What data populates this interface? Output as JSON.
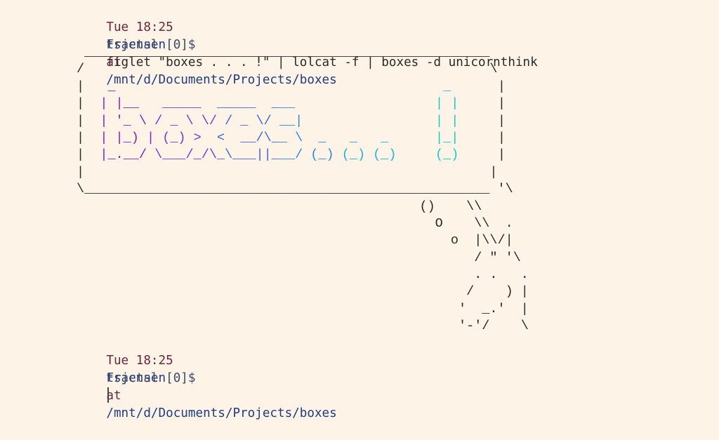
{
  "prompt1": {
    "time": "Tue 18:25",
    "user": "tsjensen",
    "at": "at",
    "path": "/mnt/d/Documents/Projects/boxes",
    "host": "Fractal [0]$",
    "command": "figlet \"boxes . . . !\" | lolcat -f | boxes -d unicornthink"
  },
  "art": {
    "border_lines": [
      " ____________________________________________________",
      "/                                                    \\",
      "|                                                    |",
      "|                                                    |",
      "|                                                    |",
      "|                                                    |",
      "|                                                    |",
      "|                                                    |",
      "\\____________________________________________________ '\\"
    ],
    "figlet_lines": [
      "  _                                          _  ",
      " | |__   _____  _____  ___                  | | ",
      " | '_ \\ / _ \\ \\/ / _ \\/ __|                 | | ",
      " | |_) | (_) >  <  __/\\__ \\  _   _   _      |_| ",
      " |_.__/ \\___/_/\\_\\___||___/ (_) (_) (_)     (_) "
    ],
    "unicorn_lines": [
      "                                            ()    \\\\",
      "                                              O    \\\\  .",
      "                                                o  |\\\\/|",
      "                                                   / \" '\\",
      "                                                   . .   .",
      "                                                  /    ) |",
      "                                                 '  _.'  |",
      "                                                 '-'/    \\"
    ],
    "gradient": [
      "#8a1fb0",
      "#6d3bd6",
      "#3e63e0",
      "#2d87df",
      "#1fb1d6",
      "#1bc8c8"
    ]
  },
  "prompt2": {
    "time": "Tue 18:25",
    "user": "tsjensen",
    "at": "at",
    "path": "/mnt/d/Documents/Projects/boxes",
    "host": "Fractal [0]$",
    "command": ""
  }
}
